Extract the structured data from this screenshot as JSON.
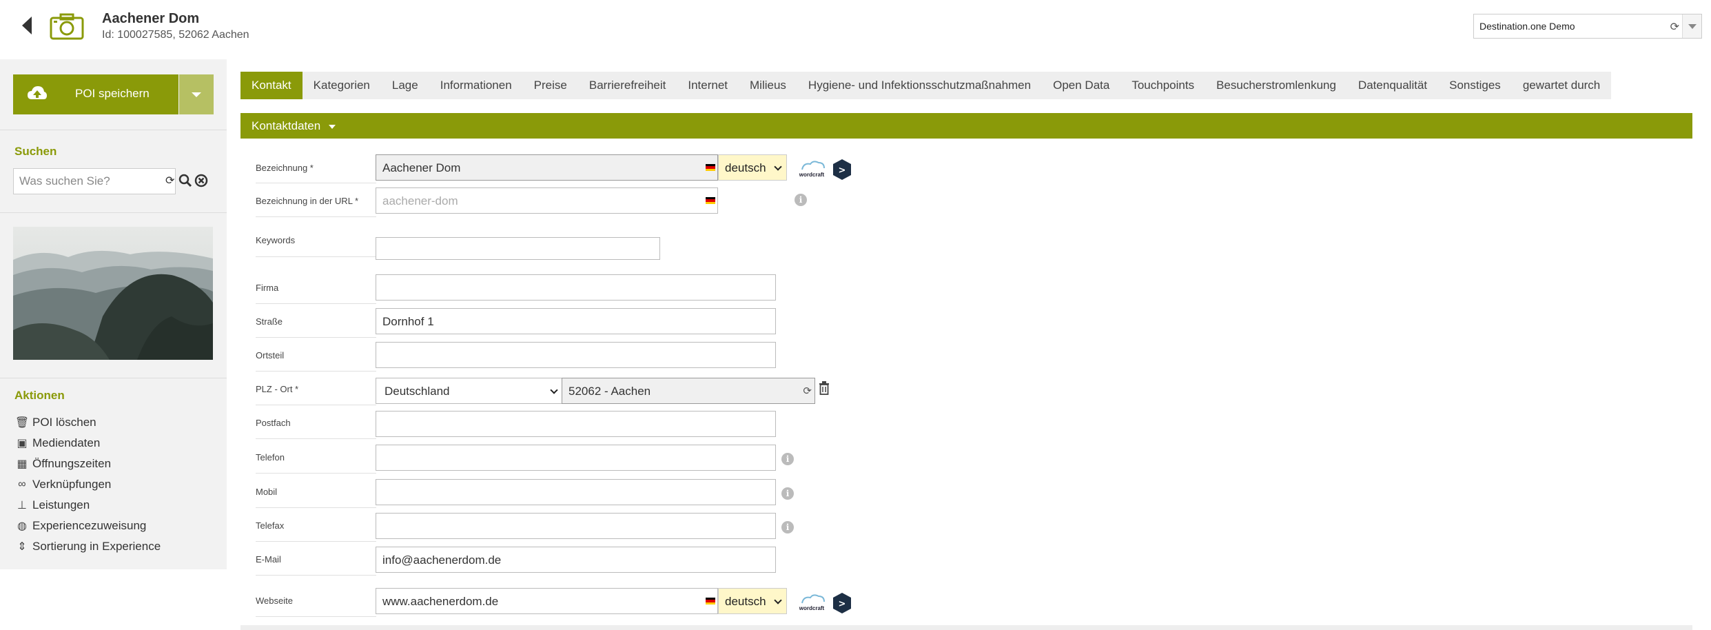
{
  "header": {
    "title": "Aachener Dom",
    "subtitle": "Id: 100027585, 52062 Aachen",
    "destination": "Destination.one Demo"
  },
  "sidebar": {
    "save_label": "POI speichern",
    "search_heading": "Suchen",
    "search_placeholder": "Was suchen Sie?",
    "actions_heading": "Aktionen",
    "actions": [
      {
        "label": "POI löschen",
        "icon": "trash-icon"
      },
      {
        "label": "Mediendaten",
        "icon": "image-icon"
      },
      {
        "label": "Öffnungszeiten",
        "icon": "calendar-icon"
      },
      {
        "label": "Verknüpfungen",
        "icon": "link-icon"
      },
      {
        "label": "Leistungen",
        "icon": "sitemap-icon"
      },
      {
        "label": "Experiencezuweisung",
        "icon": "globe-icon"
      },
      {
        "label": "Sortierung in Experience",
        "icon": "sort-icon"
      }
    ]
  },
  "tabs": [
    "Kontakt",
    "Kategorien",
    "Lage",
    "Informationen",
    "Preise",
    "Barrierefreiheit",
    "Internet",
    "Milieus",
    "Hygiene- und Infektionsschutzmaßnahmen",
    "Open Data",
    "Touchpoints",
    "Besucherstromlenkung",
    "Datenqualität",
    "Sonstiges",
    "gewartet durch"
  ],
  "section": {
    "title": "Kontaktdaten"
  },
  "form": {
    "bezeichnung_label": "Bezeichnung *",
    "bezeichnung_value": "Aachener Dom",
    "bezeichnung_lang": "deutsch",
    "url_label": "Bezeichnung in der URL *",
    "url_placeholder": "aachener-dom",
    "keywords_label": "Keywords",
    "firma_label": "Firma",
    "strasse_label": "Straße",
    "strasse_value": "Dornhof 1",
    "ortsteil_label": "Ortsteil",
    "plz_label": "PLZ - Ort *",
    "country_value": "Deutschland",
    "plz_value": "52062 - Aachen",
    "postfach_label": "Postfach",
    "telefon_label": "Telefon",
    "mobil_label": "Mobil",
    "telefax_label": "Telefax",
    "email_label": "E-Mail",
    "email_value": "info@aachenerdom.de",
    "webseite_label": "Webseite",
    "webseite_value": "www.aachenerdom.de",
    "webseite_lang": "deutsch"
  },
  "colors": {
    "accent": "#8a9a09",
    "lang_bg": "#fff7c9"
  }
}
